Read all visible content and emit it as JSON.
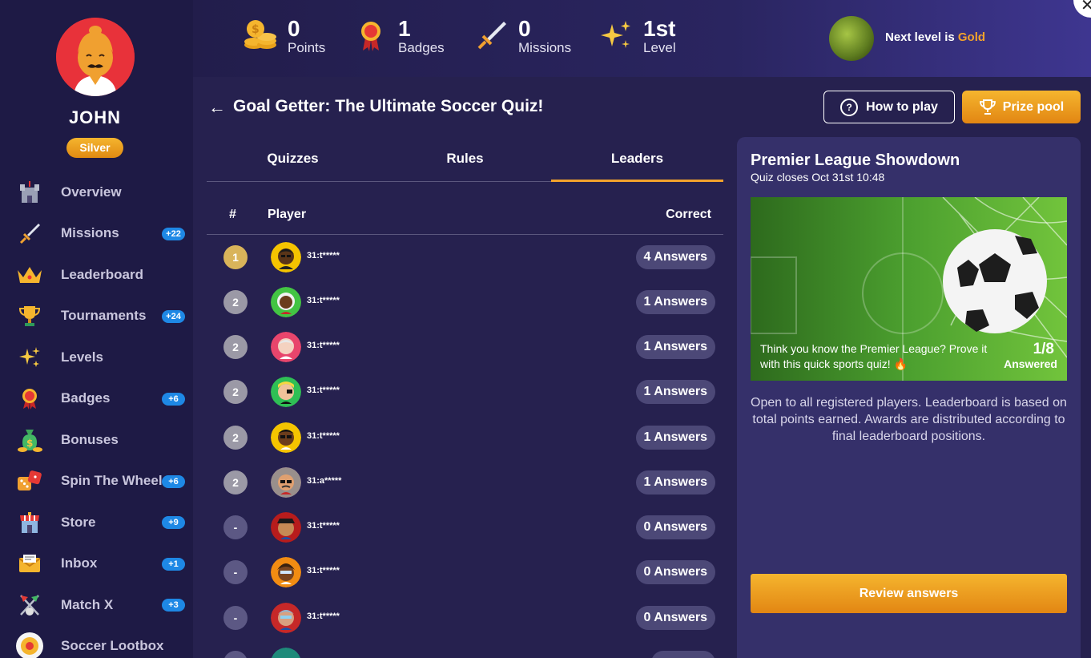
{
  "user": {
    "name": "JOHN",
    "tier": "Silver"
  },
  "nav": [
    {
      "label": "Overview",
      "icon": "castle-icon",
      "count": ""
    },
    {
      "label": "Missions",
      "icon": "sword-icon",
      "count": "+22"
    },
    {
      "label": "Leaderboard",
      "icon": "crown-icon",
      "count": ""
    },
    {
      "label": "Tournaments",
      "icon": "trophy-icon",
      "count": "+24"
    },
    {
      "label": "Levels",
      "icon": "sparkles-icon",
      "count": ""
    },
    {
      "label": "Badges",
      "icon": "medal-icon",
      "count": "+6"
    },
    {
      "label": "Bonuses",
      "icon": "money-bag-icon",
      "count": ""
    },
    {
      "label": "Spin The Wheel",
      "icon": "dice-icon",
      "count": "+6"
    },
    {
      "label": "Store",
      "icon": "store-icon",
      "count": "+9"
    },
    {
      "label": "Inbox",
      "icon": "envelope-icon",
      "count": "+1"
    },
    {
      "label": "Match X",
      "icon": "crossed-flags-icon",
      "count": "+3"
    },
    {
      "label": "Soccer Lootbox",
      "icon": "wheel-icon",
      "count": ""
    }
  ],
  "stats": {
    "points": {
      "value": "0",
      "label": "Points"
    },
    "badges": {
      "value": "1",
      "label": "Badges"
    },
    "missions": {
      "value": "0",
      "label": "Missions"
    },
    "level": {
      "value": "1st",
      "label": "Level"
    }
  },
  "next_level": {
    "prefix": "Next level is",
    "name": "Gold"
  },
  "close_label": "✕",
  "page": {
    "back": "←",
    "title": "Goal Getter: The Ultimate Soccer Quiz!",
    "how_to_play": "How to play",
    "prize_pool": "Prize pool"
  },
  "tabs": [
    "Quizzes",
    "Rules",
    "Leaders"
  ],
  "table": {
    "headers": {
      "rank": "#",
      "player": "Player",
      "correct": "Correct"
    },
    "rows": [
      {
        "rank": "1",
        "player": "31:t*****",
        "answers": "4 Answers",
        "avatar_color": "#f5c400"
      },
      {
        "rank": "2",
        "player": "31:t*****",
        "answers": "1 Answers",
        "avatar_color": "#43c443"
      },
      {
        "rank": "2",
        "player": "31:t*****",
        "answers": "1 Answers",
        "avatar_color": "#e8456c"
      },
      {
        "rank": "2",
        "player": "31:t*****",
        "answers": "1 Answers",
        "avatar_color": "#2fbf55"
      },
      {
        "rank": "2",
        "player": "31:t*****",
        "answers": "1 Answers",
        "avatar_color": "#f5c400"
      },
      {
        "rank": "2",
        "player": "31:a*****",
        "answers": "1 Answers",
        "avatar_color": "#5ad14a"
      },
      {
        "rank": "-",
        "player": "31:t*****",
        "answers": "0 Answers",
        "avatar_color": "#b71c1c"
      },
      {
        "rank": "-",
        "player": "31:t*****",
        "answers": "0 Answers",
        "avatar_color": "#f28c12"
      },
      {
        "rank": "-",
        "player": "31:t*****",
        "answers": "0 Answers",
        "avatar_color": "#c62828"
      }
    ]
  },
  "panel": {
    "title": "Premier League Showdown",
    "closes": "Quiz closes Oct 31st 10:48",
    "caption": "Think you know the Premier League? Prove it with this quick sports quiz! 🔥",
    "count": "1/8",
    "count_label": "Answered",
    "description": "Open to all registered players. Leaderboard is based on total points earned. Awards are distributed according to final leaderboard positions.",
    "review_button": "Review answers"
  }
}
